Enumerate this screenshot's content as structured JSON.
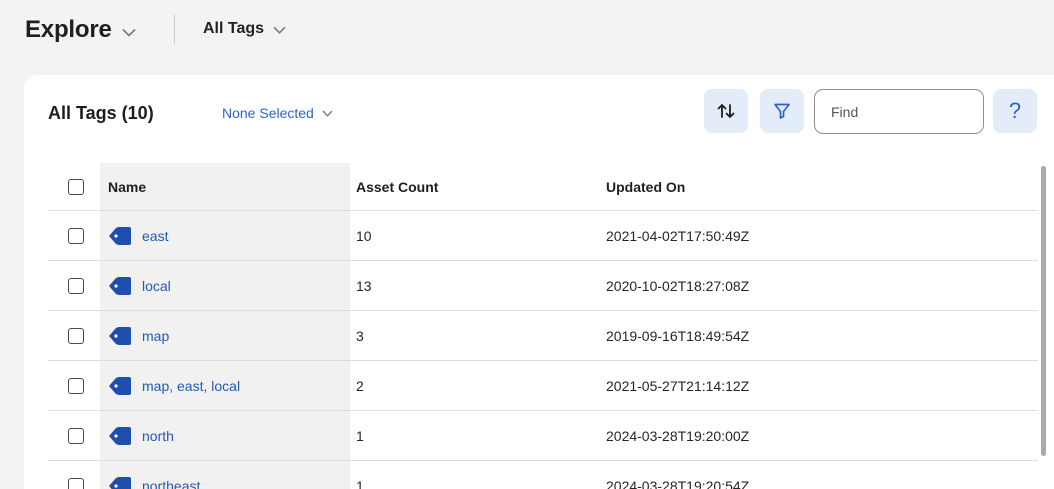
{
  "header": {
    "explore_label": "Explore",
    "scope_label": "All Tags"
  },
  "panel": {
    "title": "All Tags (10)",
    "selection_label": "None Selected",
    "find_placeholder": "Find",
    "help_label": "?"
  },
  "table": {
    "columns": [
      "Name",
      "Asset Count",
      "Updated On"
    ],
    "rows": [
      {
        "name": "east",
        "count": "10",
        "updated": "2021-04-02T17:50:49Z"
      },
      {
        "name": "local",
        "count": "13",
        "updated": "2020-10-02T18:27:08Z"
      },
      {
        "name": "map",
        "count": "3",
        "updated": "2019-09-16T18:49:54Z"
      },
      {
        "name": "map, east, local",
        "count": "2",
        "updated": "2021-05-27T21:14:12Z"
      },
      {
        "name": "north",
        "count": "1",
        "updated": "2024-03-28T19:20:00Z"
      },
      {
        "name": "northeast",
        "count": "1",
        "updated": "2024-03-28T19:20:54Z"
      }
    ]
  },
  "icons": {
    "tag": "tag-icon",
    "sort": "sort-icon",
    "filter": "filter-icon",
    "chevron": "chevron-down-icon"
  },
  "colors": {
    "accent": "#2f63c6",
    "tag_icon": "#1f4fae",
    "button_bg": "#e4ecfa",
    "page_bg": "#f3f3f3"
  }
}
